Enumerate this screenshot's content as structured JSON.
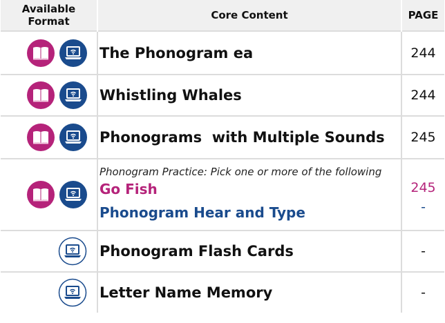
{
  "header": {
    "format": "Available Format",
    "content": "Core Content",
    "page": "PAGE"
  },
  "colors": {
    "book_icon": "#b5237a",
    "laptop_icon": "#1a4b8d",
    "go_fish": "#b5237a",
    "hear_type": "#1a4b8d"
  },
  "rows": [
    {
      "title": "The Phonogram ea",
      "page": "244",
      "formats": [
        "book-icon",
        "laptop-icon"
      ]
    },
    {
      "title": "Whistling Whales",
      "page": "244",
      "formats": [
        "book-icon",
        "laptop-icon"
      ]
    },
    {
      "title": "Phonograms  with Multiple Sounds",
      "page": "245",
      "formats": [
        "book-icon",
        "laptop-icon"
      ]
    },
    {
      "note": "Phonogram Practice: Pick one or more of the following",
      "option1": "Go Fish",
      "option2": "Phonogram Hear and Type",
      "page1": "245",
      "page2": "-",
      "formats": [
        "book-icon",
        "laptop-icon"
      ]
    },
    {
      "title": "Phonogram Flash Cards",
      "page": "-",
      "formats": [
        "laptop-outline-icon"
      ]
    },
    {
      "title": "Letter Name Memory",
      "page": "-",
      "formats": [
        "laptop-outline-icon"
      ]
    }
  ]
}
